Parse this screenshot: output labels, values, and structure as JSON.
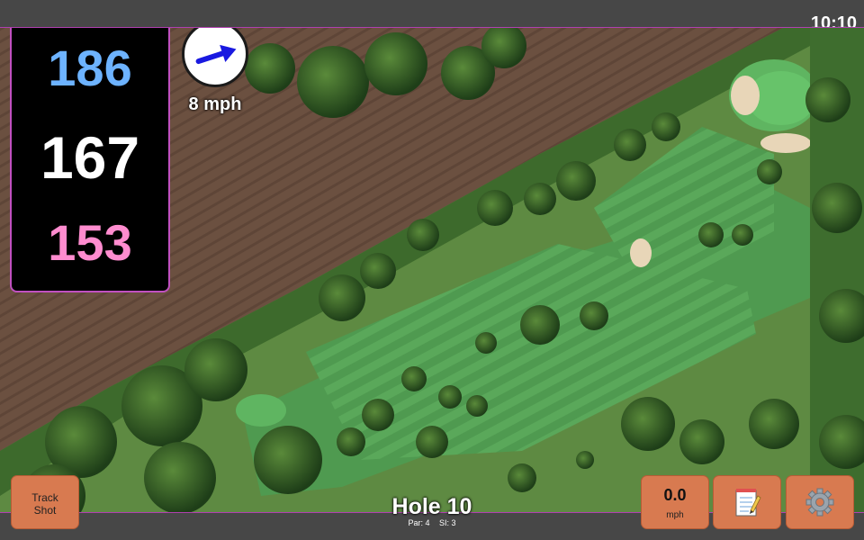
{
  "status": {
    "time": "10:10"
  },
  "distances": {
    "back": "186",
    "middle": "167",
    "front": "153"
  },
  "wind": {
    "speed": "8 mph",
    "icon": "wind-arrow-icon"
  },
  "buttons": {
    "track_shot": {
      "line1": "Track",
      "line2": "Shot"
    },
    "speed": {
      "value": "0.0",
      "unit": "mph"
    },
    "notes_icon": "notepad-icon",
    "settings_icon": "gear-icon"
  },
  "hole": {
    "title": "Hole 10",
    "par": "Par: 4",
    "si": "SI: 3"
  },
  "colors": {
    "back_distance": "#6db3ff",
    "middle_distance": "#ffffff",
    "front_distance": "#ff8ccf",
    "button": "#d87a50",
    "panel_border": "#c050c0"
  }
}
